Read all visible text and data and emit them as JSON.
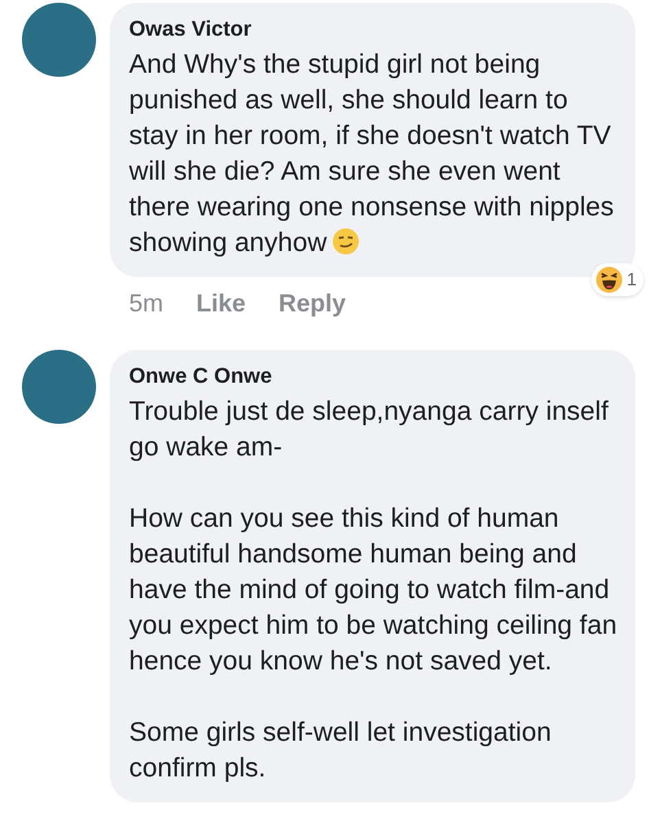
{
  "comments": [
    {
      "author": "Owas Victor",
      "paragraphs": [
        "And Why's the stupid girl not being punished as well, she should learn to stay in her room, if she doesn't watch TV will she die? Am sure she even went there wearing one nonsense with nipples showing anyhow"
      ],
      "ends_with_emoji": true,
      "time": "5m",
      "actions": [
        "Like",
        "Reply"
      ],
      "reaction": {
        "kind": "haha",
        "count": "1"
      }
    },
    {
      "author": "Onwe C Onwe",
      "paragraphs": [
        "Trouble just de sleep,nyanga carry inself go wake am-",
        "How can you see this kind of human beautiful handsome human being and have the mind of going to watch film-and you expect him to be watching ceiling fan hence you know he's not saved yet.",
        "Some girls self-well let investigation confirm pls."
      ]
    }
  ]
}
